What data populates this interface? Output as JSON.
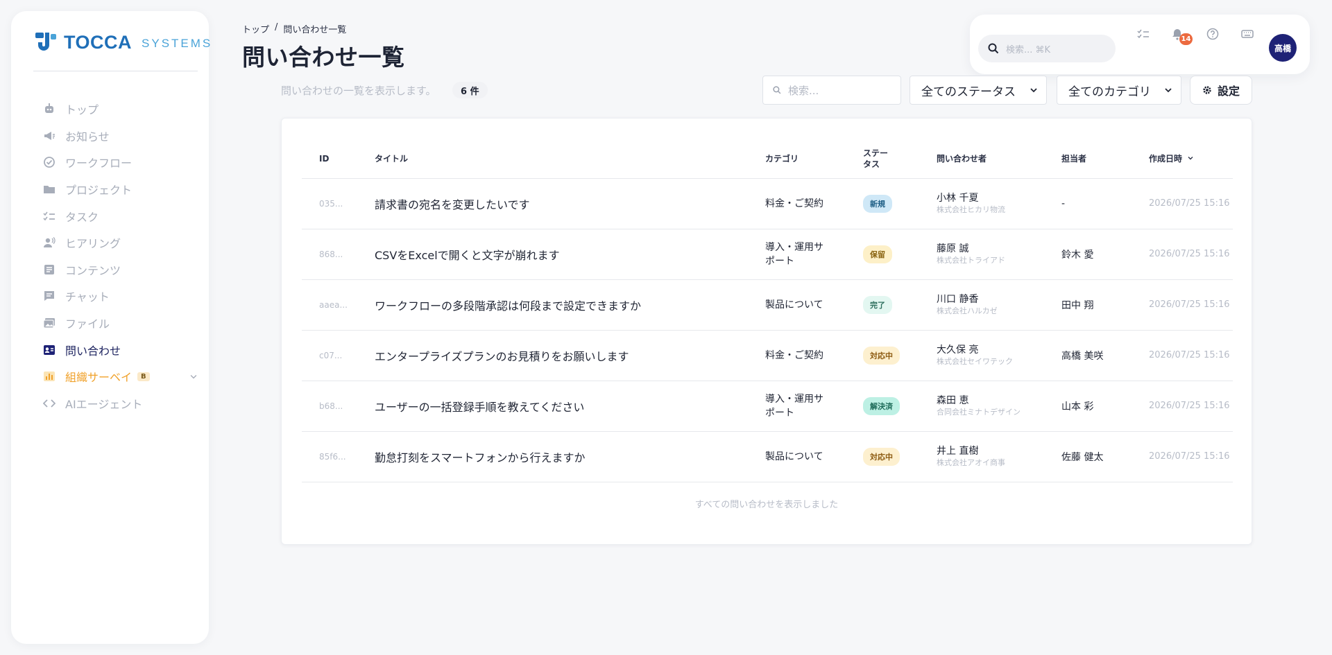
{
  "brand": {
    "name": "TOCCA",
    "suffix": "SYSTEMS"
  },
  "sidebar": {
    "items": [
      {
        "label": "トップ",
        "icon": "robot-icon"
      },
      {
        "label": "お知らせ",
        "icon": "megaphone-icon"
      },
      {
        "label": "ワークフロー",
        "icon": "check-circle-icon"
      },
      {
        "label": "プロジェクト",
        "icon": "folder-icon"
      },
      {
        "label": "タスク",
        "icon": "checklist-icon"
      },
      {
        "label": "ヒアリング",
        "icon": "person-voice-icon"
      },
      {
        "label": "コンテンツ",
        "icon": "document-icon"
      },
      {
        "label": "チャット",
        "icon": "chat-icon"
      },
      {
        "label": "ファイル",
        "icon": "images-icon"
      },
      {
        "label": "問い合わせ",
        "icon": "contact-card-icon",
        "active": true
      },
      {
        "label": "組織サーベイ",
        "icon": "bar-chart-icon",
        "badge": "B"
      },
      {
        "label": "AIエージェント",
        "icon": "code-icon"
      }
    ]
  },
  "breadcrumb": {
    "home": "トップ",
    "separator": "/",
    "current": "問い合わせ一覧"
  },
  "page": {
    "title": "問い合わせ一覧",
    "subtitle": "問い合わせの一覧を表示します。",
    "count": "6 件"
  },
  "topbar": {
    "search_placeholder": "検索... ⌘K",
    "notification_count": "14",
    "avatar": "高橋"
  },
  "toolbar": {
    "search_placeholder": "検索...",
    "status_filter": "全てのステータス",
    "category_filter": "全てのカテゴリ",
    "settings_label": "設定"
  },
  "table": {
    "headers": {
      "id": "ID",
      "title": "タイトル",
      "category": "カテゴリ",
      "status": "ステータス",
      "requester": "問い合わせ者",
      "assignee": "担当者",
      "created": "作成日時"
    },
    "rows": [
      {
        "id": "035...",
        "title": "請求書の宛名を変更したいです",
        "category": "料金・ご契約",
        "status": "新規",
        "requester": "小林 千夏",
        "company": "株式会社ヒカリ物流",
        "assignee": "-",
        "created": "2026/07/25 15:16"
      },
      {
        "id": "868...",
        "title": "CSVをExcelで開くと文字が崩れます",
        "category": "導入・運用サポート",
        "status": "保留",
        "requester": "藤原 誠",
        "company": "株式会社トライアド",
        "assignee": "鈴木 愛",
        "created": "2026/07/25 15:16"
      },
      {
        "id": "aaea...",
        "title": "ワークフローの多段階承認は何段まで設定できますか",
        "category": "製品について",
        "status": "完了",
        "requester": "川口 静香",
        "company": "株式会社ハルカゼ",
        "assignee": "田中 翔",
        "created": "2026/07/25 15:16"
      },
      {
        "id": "c07...",
        "title": "エンタープライズプランのお見積りをお願いします",
        "category": "料金・ご契約",
        "status": "対応中",
        "requester": "大久保 亮",
        "company": "株式会社セイワテック",
        "assignee": "高橋 美咲",
        "created": "2026/07/25 15:16"
      },
      {
        "id": "b68...",
        "title": "ユーザーの一括登録手順を教えてください",
        "category": "導入・運用サポート",
        "status": "解決済",
        "requester": "森田 恵",
        "company": "合同会社ミナトデザイン",
        "assignee": "山本 彩",
        "created": "2026/07/25 15:16"
      },
      {
        "id": "85f6...",
        "title": "勤怠打刻をスマートフォンから行えますか",
        "category": "製品について",
        "status": "対応中",
        "requester": "井上 直樹",
        "company": "株式会社アオイ商事",
        "assignee": "佐藤 健太",
        "created": "2026/07/25 15:16"
      }
    ],
    "footer": "すべての問い合わせを表示しました"
  },
  "status_colors": {
    "新規": {
      "bg": "#cfe8f7",
      "fg": "#1f5f86"
    },
    "保留": {
      "bg": "#fdf0c8",
      "fg": "#8a6412"
    },
    "完了": {
      "bg": "#e3f7f1",
      "fg": "#2c6e5c"
    },
    "対応中": {
      "bg": "#fdf0cf",
      "fg": "#8c5a10"
    },
    "解決済": {
      "bg": "#bdf0e4",
      "fg": "#1e6b59"
    }
  },
  "colors": {
    "accent": "#1e2276",
    "brand": "#1f6fb8",
    "survey": "#f0a12a",
    "notification": "#ec6a3f"
  }
}
